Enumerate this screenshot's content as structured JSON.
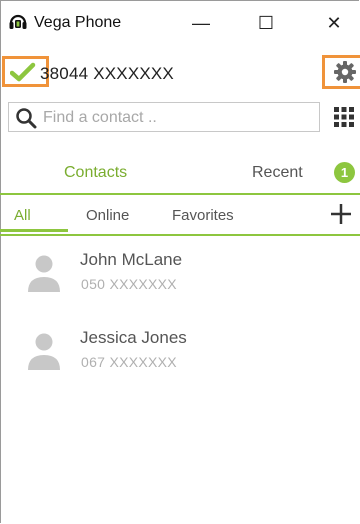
{
  "window": {
    "title": "Vega Phone",
    "minimize_glyph": "—",
    "maximize_glyph": "☐",
    "close_glyph": "✕"
  },
  "account": {
    "status_icon": "check-icon",
    "status_color": "#8dc63f",
    "number": "38044 XXXXXXX",
    "settings_icon": "gear-icon"
  },
  "search": {
    "placeholder": "Find a contact ..",
    "value": ""
  },
  "tabs": [
    {
      "label": "Contacts",
      "active": true
    },
    {
      "label": "Recent",
      "active": false,
      "badge": "1"
    }
  ],
  "filters": [
    {
      "label": "All",
      "active": true
    },
    {
      "label": "Online",
      "active": false
    },
    {
      "label": "Favorites",
      "active": false
    }
  ],
  "contacts": [
    {
      "name": "John McLane",
      "number": "050 XXXXXXX"
    },
    {
      "name": "Jessica Jones",
      "number": "067 XXXXXXX"
    }
  ],
  "colors": {
    "accent": "#8dc63f",
    "highlight_frame": "#f0933a"
  }
}
